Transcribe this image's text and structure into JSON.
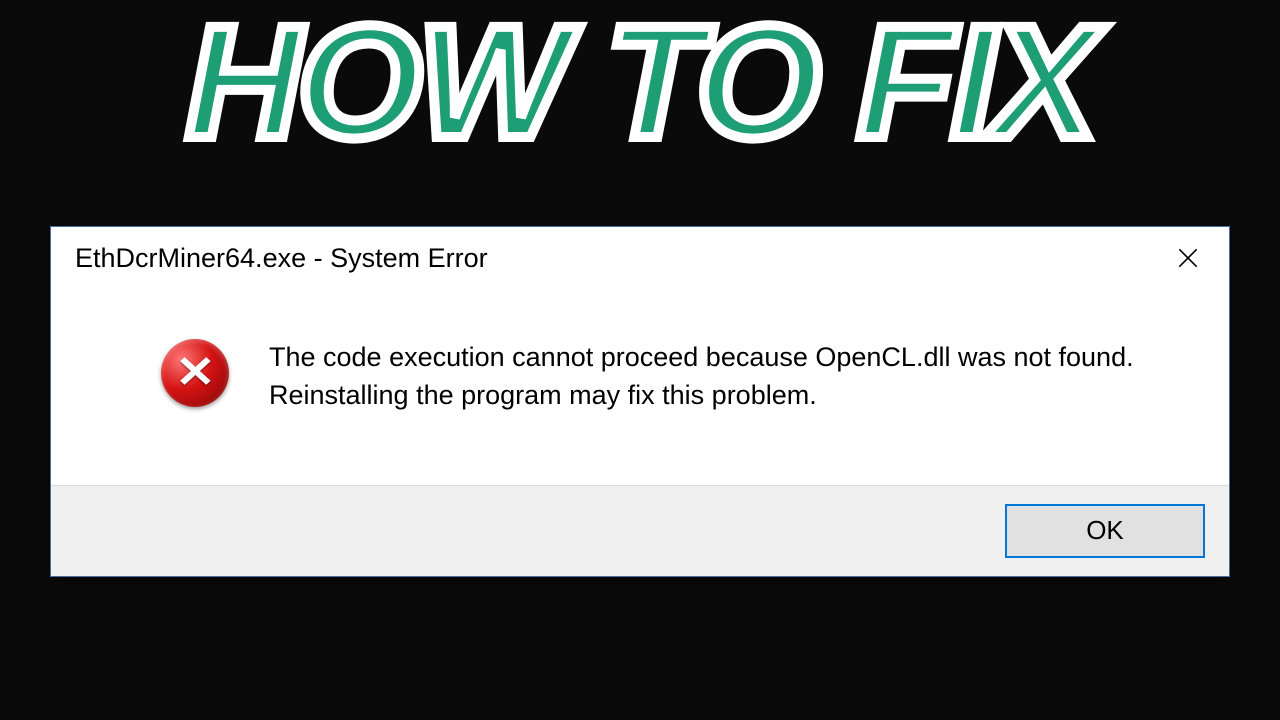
{
  "thumbnail": {
    "title": "HOW TO FIX"
  },
  "dialog": {
    "title": "EthDcrMiner64.exe - System Error",
    "message": "The code execution cannot proceed because OpenCL.dll was not found. Reinstalling the program may fix this problem.",
    "ok_label": "OK",
    "icon": "error-icon"
  }
}
